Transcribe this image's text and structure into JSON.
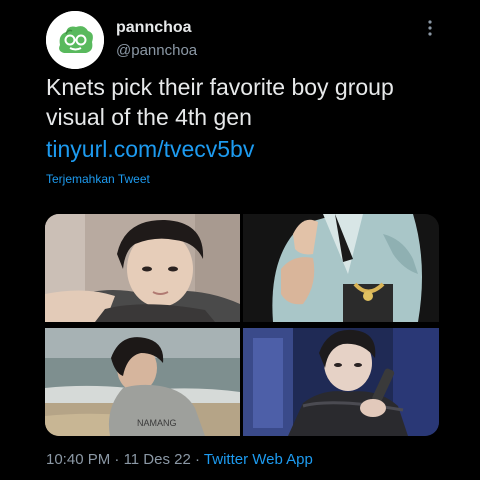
{
  "tweet": {
    "display_name": "pannchoa",
    "handle": "@pannchoa",
    "text": "Knets pick their favorite boy group visual of the 4th gen",
    "link": "tinyurl.com/tvecv5bv",
    "translate_label": "Terjemahkan Tweet",
    "time": "10:40 PM",
    "date": "11 Des 22",
    "source": "Twitter Web App",
    "separator": "·",
    "more_icon": "more-dots-icon",
    "hoodie_text": "NAMANG"
  },
  "colors": {
    "background": "#000000",
    "primary_text": "#e7e9ea",
    "secondary_text": "#8b98a5",
    "link": "#1d9bf0",
    "avatar_green": "#4caf50"
  }
}
